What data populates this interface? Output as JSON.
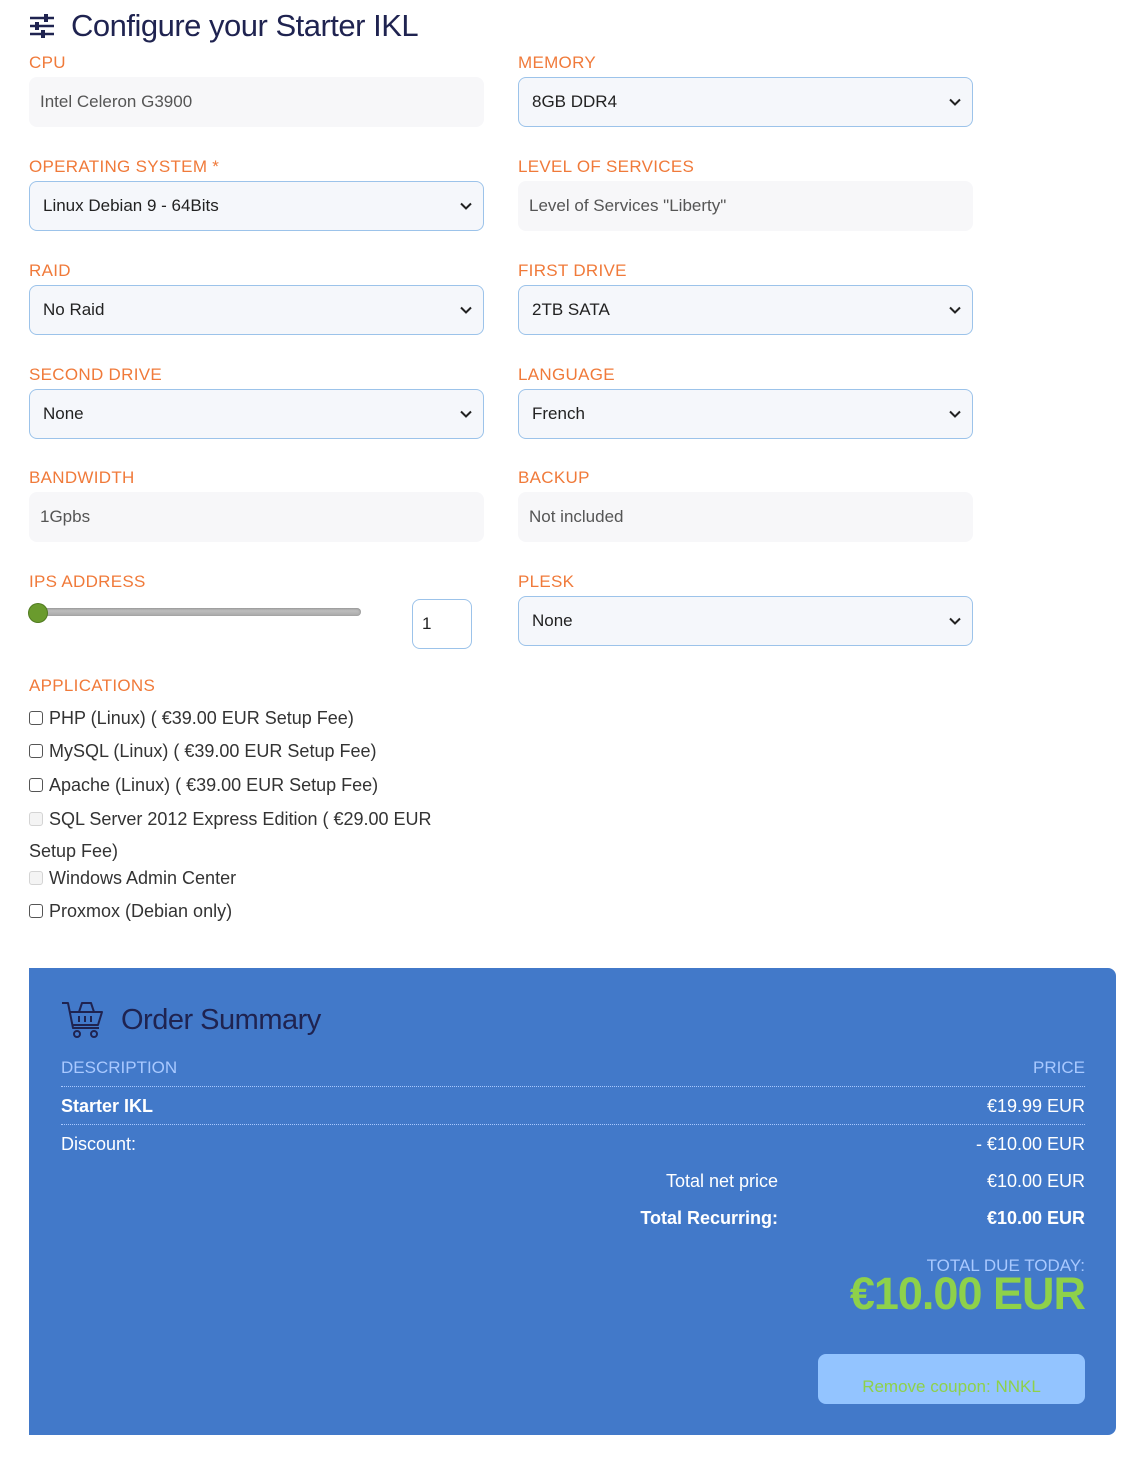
{
  "header": {
    "title": "Configure your Starter IKL"
  },
  "fields": {
    "cpu": {
      "label": "CPU",
      "value": "Intel Celeron G3900"
    },
    "memory": {
      "label": "MEMORY",
      "value": "8GB DDR4"
    },
    "os": {
      "label": "OPERATING SYSTEM *",
      "value": "Linux Debian 9 - 64Bits"
    },
    "level": {
      "label": "LEVEL OF SERVICES",
      "value": "Level of Services \"Liberty\""
    },
    "raid": {
      "label": "RAID",
      "value": "No Raid"
    },
    "first_drive": {
      "label": "FIRST DRIVE",
      "value": "2TB SATA"
    },
    "second_drive": {
      "label": "SECOND DRIVE",
      "value": "None"
    },
    "language": {
      "label": "LANGUAGE",
      "value": "French"
    },
    "bandwidth": {
      "label": "BANDWIDTH",
      "value": "1Gpbs"
    },
    "backup": {
      "label": "BACKUP",
      "value": "Not included"
    },
    "ips": {
      "label": "IPS ADDRESS",
      "value": "1",
      "slider_fraction": 0
    },
    "plesk": {
      "label": "PLESK",
      "value": "None"
    }
  },
  "applications": {
    "label": "APPLICATIONS",
    "items": [
      {
        "label": "PHP (Linux) ( €39.00 EUR Setup Fee)",
        "enabled": true
      },
      {
        "label": "MySQL (Linux) ( €39.00 EUR Setup Fee)",
        "enabled": true
      },
      {
        "label": "Apache (Linux) ( €39.00 EUR Setup Fee)",
        "enabled": true
      },
      {
        "label": "SQL Server 2012 Express Edition ( €29.00 EUR Setup Fee)",
        "enabled": false
      },
      {
        "label": "Windows Admin Center",
        "enabled": false
      },
      {
        "label": "Proxmox (Debian only)",
        "enabled": true
      }
    ]
  },
  "summary": {
    "title": "Order Summary",
    "desc_header": "DESCRIPTION",
    "price_header": "PRICE",
    "product_name": "Starter IKL",
    "product_price": "€19.99 EUR",
    "discount_label": "Discount:",
    "discount_value": "- €10.00 EUR",
    "net_label": "Total net price",
    "net_value": "€10.00 EUR",
    "recurring_label": "Total Recurring:",
    "recurring_value": "€10.00 EUR",
    "due_label": "TOTAL DUE TODAY:",
    "due_value": "€10.00 EUR",
    "coupon_button": "Remove coupon: NNKL"
  },
  "colors": {
    "label_orange": "#f07a3a",
    "summary_bg": "#4279c9",
    "accent_green": "#8ed14a",
    "title_navy": "#1f2350"
  }
}
